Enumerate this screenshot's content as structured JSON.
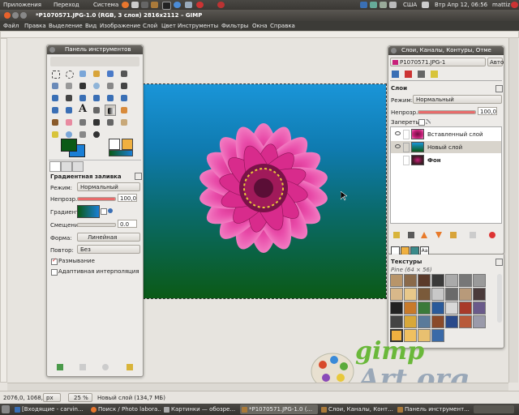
{
  "system_panel": {
    "apps": "Приложения",
    "places": "Переход",
    "system": "Система",
    "keyboard": "США",
    "datetime": "Втр Апр 12, 06:56",
    "user": "mattiz"
  },
  "window": {
    "title": "*P1070571.JPG-1.0 (RGB, 3 слоя) 2816x2112 – GIMP"
  },
  "menu": {
    "items": [
      "Файл",
      "Правка",
      "Выделение",
      "Вид",
      "Изображение",
      "Слой",
      "Цвет",
      "Инструменты",
      "Фильтры",
      "Окна",
      "Справка"
    ]
  },
  "toolbox": {
    "title": "Панель инструментов",
    "section": "Градиентная заливка",
    "mode_label": "Режим:",
    "mode_value": "Нормальный",
    "opacity_label": "Непрозр.:",
    "opacity_value": "100,0",
    "opacity_fraction": 1.0,
    "gradient_label": "Градиент:",
    "offset_label": "Смещение:",
    "offset_value": "0.0",
    "shape_label": "Форма:",
    "shape_value": "Линейная",
    "repeat_label": "Повтор:",
    "repeat_value": "Без",
    "dither_label": "Размывание",
    "dither_checked": true,
    "adaptive_label": "Адаптивная интерполяция",
    "adaptive_checked": false,
    "fg_color": "#0b5a16",
    "bg_color": "#1a7fd6"
  },
  "layers_dialog": {
    "title": "Слои, Каналы, Контуры, Отме",
    "image_select": "P1070571.JPG-1",
    "auto_button": "Авто",
    "section": "Слои",
    "mode_label": "Режим:",
    "mode_value": "Нормальный",
    "opacity_label": "Непрозр.:",
    "opacity_value": "100,0",
    "opacity_fraction": 1.0,
    "lock_label": "Запереть:",
    "layers": [
      {
        "name": "Вставленный слой",
        "selected": false
      },
      {
        "name": "Новый слой",
        "selected": true
      },
      {
        "name": "Фон",
        "selected": false
      }
    ]
  },
  "patterns_dialog": {
    "title": "Текстуры",
    "pattern_name": "Pine (64 × 56)"
  },
  "statusbar": {
    "coords": "2076,0, 1068,0",
    "unit": "px",
    "zoom": "25 %",
    "message": "Новый слой (134,7 МБ)"
  },
  "watermark": {
    "line1": "gimp",
    "line2": "Art.org"
  },
  "taskbar": {
    "items": [
      "[Входящие - carvin...",
      "Поиск / Photo labora...",
      "Картинки — обозре...",
      "*P1070571.JPG-1.0 (...",
      "Слои, Каналы, Конт...",
      "Панель инструмент..."
    ]
  }
}
